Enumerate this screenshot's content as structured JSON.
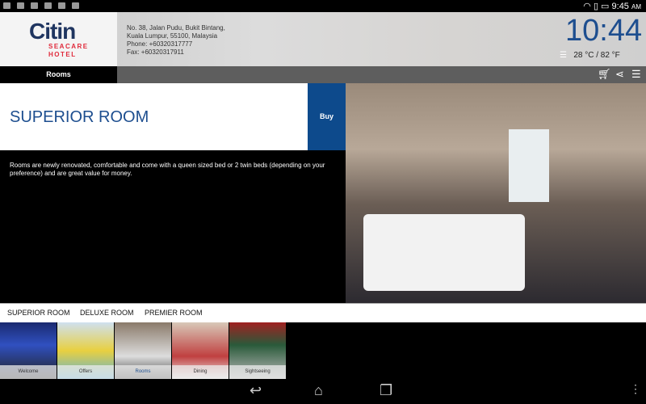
{
  "status_bar": {
    "time": "9:45",
    "ampm": "AM"
  },
  "header": {
    "logo_main": "Citin",
    "logo_sub1": "SEACARE",
    "logo_sub2": "HOTEL",
    "address": [
      "No. 38, Jalan Pudu, Bukit Bintang,",
      "Kuala Lumpur, 55100, Malaysia",
      "Phone: +60320317777",
      "Fax: +60320317911"
    ],
    "clock": "10:44",
    "weather": "28 °C / 82 °F"
  },
  "nav": {
    "active": "Rooms"
  },
  "room": {
    "title": "SUPERIOR ROOM",
    "buy": "Buy",
    "description": "Rooms are newly renovated, comfortable and come with a queen sized bed or 2 twin beds (depending on your preference) and are great value for money."
  },
  "room_tabs": [
    "SUPERIOR ROOM",
    "DELUXE ROOM",
    "PREMIER ROOM"
  ],
  "thumbs": [
    "Welcome",
    "Offers",
    "Rooms",
    "Dining",
    "Sightseeing"
  ],
  "colors": {
    "accent": "#0d4a8c",
    "logo_red": "#e02a3b"
  }
}
